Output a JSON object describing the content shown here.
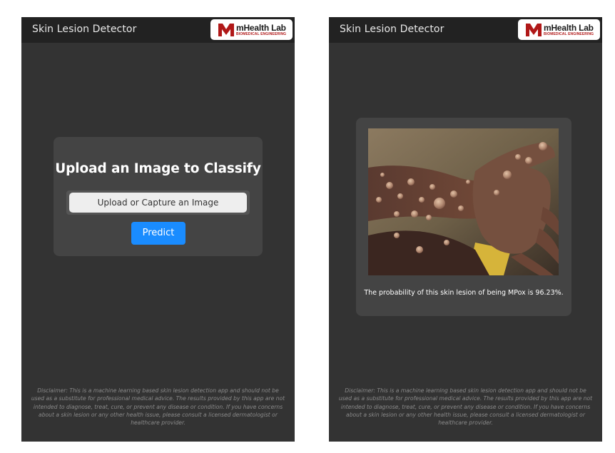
{
  "app": {
    "title": "Skin Lesion Detector",
    "logo": {
      "name": "mHealth Lab",
      "subtitle": "BIOMEDICAL ENGINEERING",
      "icon": "mhealth-lab-logo-icon"
    }
  },
  "colors": {
    "background": "#333333",
    "appbar": "#222222",
    "card": "#444444",
    "accent": "#1a8cff",
    "logo_red": "#b01818"
  },
  "upload_screen": {
    "heading": "Upload an Image to Classify",
    "upload_label": "Upload or Capture an Image",
    "predict_label": "Predict"
  },
  "result_screen": {
    "image_icon": "skin-lesion-photo",
    "result_text": "The probability of this skin lesion of being MPox is 96.23%."
  },
  "disclaimer": "Disclaimer: This is a machine learning based skin lesion detection app and should not be used as a substitute for professional medical advice. The results provided by this app are not intended to diagnose, treat, cure, or prevent any disease or condition. If you have concerns about a skin lesion or any other health issue, please consult a licensed dermatologist or healthcare provider."
}
